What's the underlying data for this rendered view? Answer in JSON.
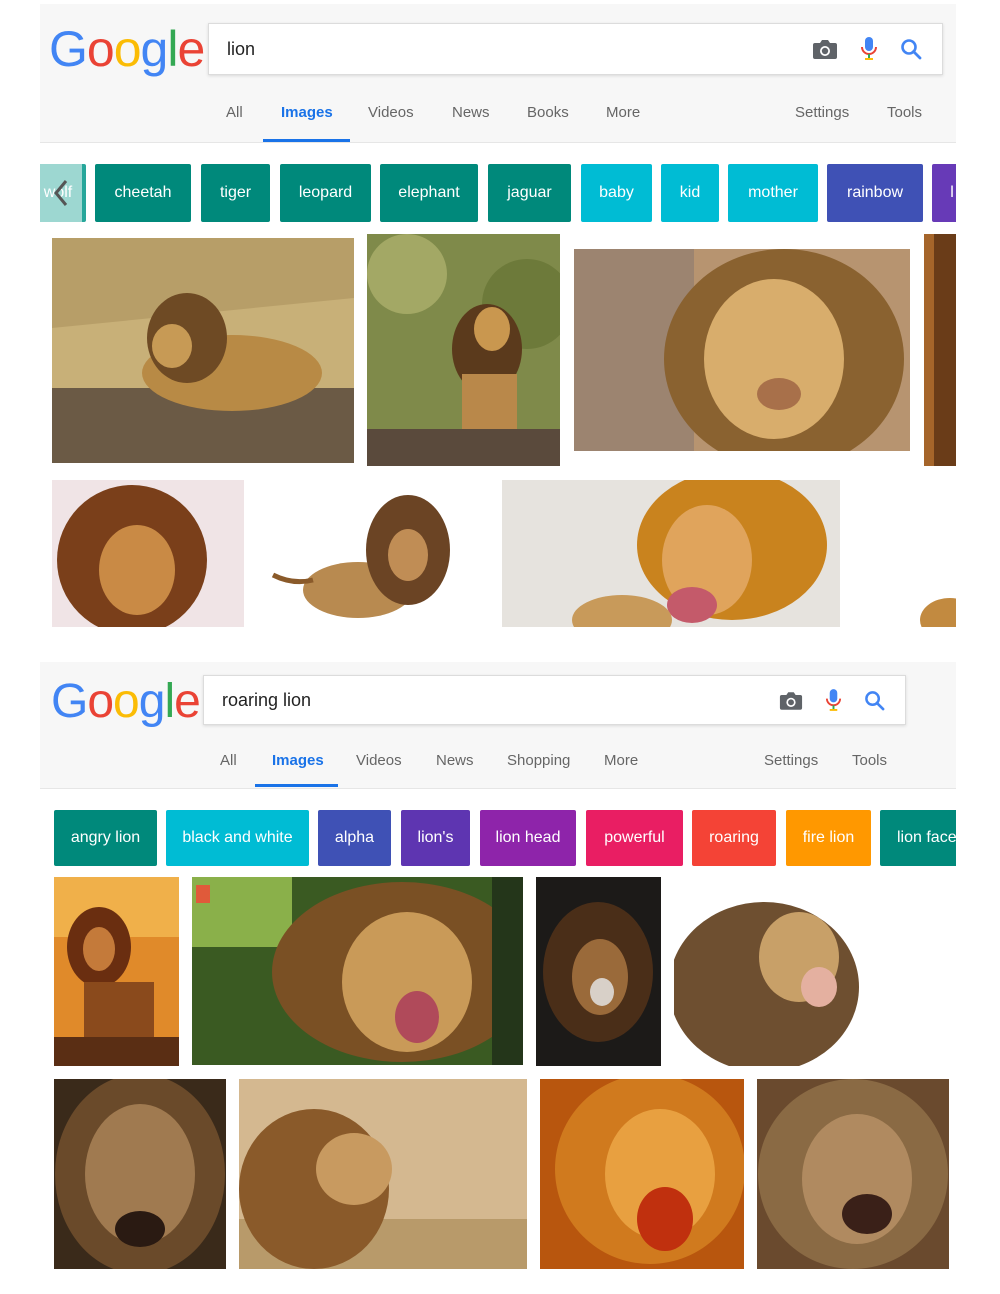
{
  "logo": {
    "letters": [
      "G",
      "o",
      "o",
      "g",
      "l",
      "e"
    ]
  },
  "top": {
    "search": {
      "value": "lion"
    },
    "tabs": {
      "all": "All",
      "images": "Images",
      "videos": "Videos",
      "news": "News",
      "books": "Books",
      "more": "More",
      "settings": "Settings",
      "tools": "Tools"
    },
    "chips": [
      {
        "label": "wolf",
        "color": "#26a69a"
      },
      {
        "label": "cheetah",
        "color": "#00897b"
      },
      {
        "label": "tiger",
        "color": "#00897b"
      },
      {
        "label": "leopard",
        "color": "#00897b"
      },
      {
        "label": "elephant",
        "color": "#00897b"
      },
      {
        "label": "jaguar",
        "color": "#00897b"
      },
      {
        "label": "baby",
        "color": "#00bcd4"
      },
      {
        "label": "kid",
        "color": "#00bcd4"
      },
      {
        "label": "mother",
        "color": "#00bcd4"
      },
      {
        "label": "rainbow",
        "color": "#3f51b5"
      },
      {
        "label": "l",
        "color": "#673ab7"
      }
    ]
  },
  "bottom": {
    "search": {
      "value": "roaring lion"
    },
    "tabs": {
      "all": "All",
      "images": "Images",
      "videos": "Videos",
      "news": "News",
      "shopping": "Shopping",
      "more": "More",
      "settings": "Settings",
      "tools": "Tools"
    },
    "chips": [
      {
        "label": "angry lion",
        "color": "#00897b"
      },
      {
        "label": "black and white",
        "color": "#00bcd4"
      },
      {
        "label": "alpha",
        "color": "#3f51b5"
      },
      {
        "label": "lion's",
        "color": "#5e35b1"
      },
      {
        "label": "lion head",
        "color": "#8e24aa"
      },
      {
        "label": "powerful",
        "color": "#e91e63"
      },
      {
        "label": "roaring",
        "color": "#f44336"
      },
      {
        "label": "fire lion",
        "color": "#ff9800"
      },
      {
        "label": "lion face",
        "color": "#00897b"
      }
    ]
  },
  "colors": {
    "accent": "#1a73e8"
  }
}
